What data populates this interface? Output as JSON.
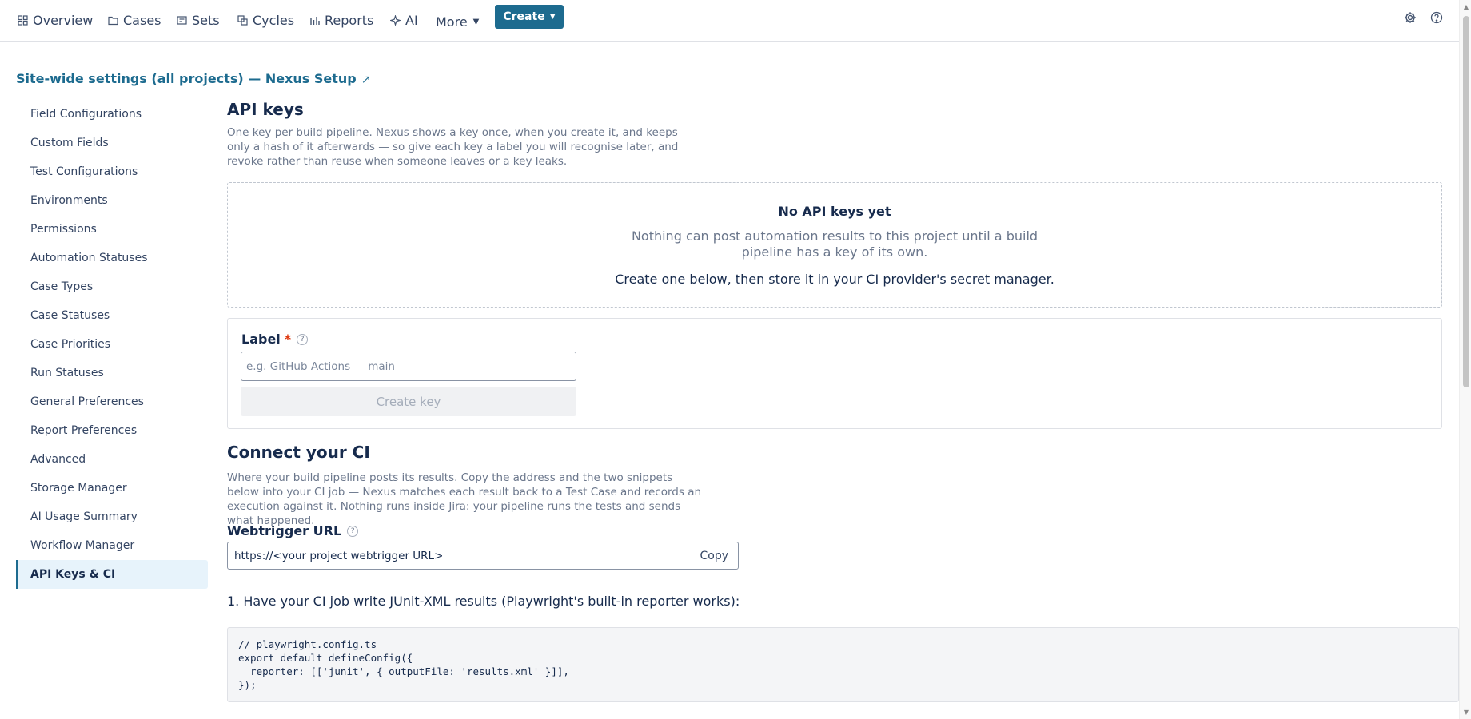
{
  "nav": {
    "items": [
      {
        "label": "Overview",
        "icon": "grid-icon"
      },
      {
        "label": "Cases",
        "icon": "folder-icon"
      },
      {
        "label": "Sets",
        "icon": "set-icon"
      },
      {
        "label": "Cycles",
        "icon": "copy-icon"
      },
      {
        "label": "Reports",
        "icon": "bar-chart-icon"
      },
      {
        "label": "AI",
        "icon": "sparkle-icon"
      }
    ],
    "more_label": "More",
    "create_label": "Create"
  },
  "page": {
    "site_title": "Site-wide settings (all projects) — Nexus Setup",
    "external_glyph": "↗"
  },
  "sidebar": {
    "items": [
      "Field Configurations",
      "Custom Fields",
      "Test Configurations",
      "Environments",
      "Permissions",
      "Automation Statuses",
      "Case Types",
      "Case Statuses",
      "Case Priorities",
      "Run Statuses",
      "General Preferences",
      "Report Preferences",
      "Advanced",
      "Storage Manager",
      "AI Usage Summary",
      "Workflow Manager",
      "API Keys & CI"
    ],
    "active": "API Keys & CI"
  },
  "api_keys": {
    "title": "API keys",
    "description": "One key per build pipeline. Nexus shows a key once, when you create it, and keeps only a hash of it afterwards — so give each key a label you will recognise later, and revoke rather than reuse when someone leaves or a key leaks.",
    "empty_title": "No API keys yet",
    "empty_text": "Nothing can post automation results to this project until a build pipeline has a key of its own.",
    "empty_cta": "Create one below, then store it in your CI provider's secret manager.",
    "label_field": "Label",
    "required_mark": "*",
    "help_glyph": "?",
    "label_placeholder": "e.g. GitHub Actions — main",
    "label_value": "",
    "create_key_label": "Create key"
  },
  "ci": {
    "title": "Connect your CI",
    "description": "Where your build pipeline posts its results. Copy the address and the two snippets below into your CI job — Nexus matches each result back to a Test Case and records an execution against it. Nothing runs inside Jira: your pipeline runs the tests and sends what happened.",
    "webtrigger_label": "Webtrigger URL",
    "webtrigger_url": "https://<your project webtrigger URL>",
    "copy_label": "Copy",
    "step1": "1. Have your CI job write JUnit-XML results (Playwright's built-in reporter works):",
    "code": "// playwright.config.ts\nexport default defineConfig({\n  reporter: [['junit', { outputFile: 'results.xml' }]],\n});"
  }
}
